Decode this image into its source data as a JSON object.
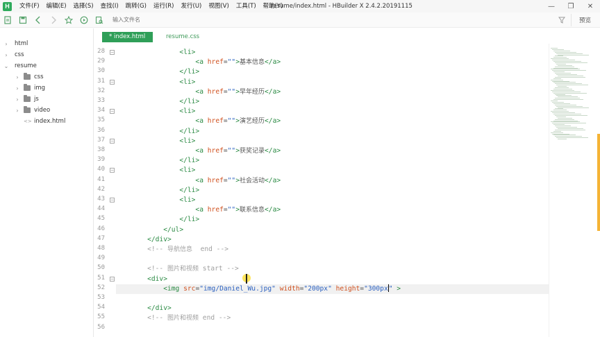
{
  "titlebar": {
    "menu": [
      "文件(F)",
      "编辑(E)",
      "选择(S)",
      "查找(I)",
      "跳转(G)",
      "运行(R)",
      "发行(U)",
      "视图(V)",
      "工具(T)",
      "帮助(Y)"
    ],
    "window_title": "resume/index.html - HBuilder X 2.4.2.20191115",
    "controls": [
      "minimize",
      "restore",
      "close"
    ]
  },
  "toolbar": {
    "search_placeholder": "输入文件名",
    "preview_label": "预览",
    "icons": [
      "new-file-icon",
      "save-icon",
      "back-icon",
      "forward-icon",
      "star-icon",
      "run-icon",
      "browser-preview-icon"
    ]
  },
  "sidebar": {
    "items": [
      {
        "label": "html",
        "type": "folder",
        "expanded": false,
        "depth": 0
      },
      {
        "label": "css",
        "type": "folder",
        "expanded": false,
        "depth": 0
      },
      {
        "label": "resume",
        "type": "folder",
        "expanded": true,
        "depth": 0
      },
      {
        "label": "css",
        "type": "folder",
        "expanded": false,
        "depth": 1
      },
      {
        "label": "img",
        "type": "folder",
        "expanded": false,
        "depth": 1
      },
      {
        "label": "js",
        "type": "folder",
        "expanded": false,
        "depth": 1
      },
      {
        "label": "video",
        "type": "folder",
        "expanded": false,
        "depth": 1
      },
      {
        "label": "index.html",
        "type": "file",
        "depth": 1
      }
    ]
  },
  "tabs": [
    {
      "label": "* index.html",
      "active": true
    },
    {
      "label": "resume.css",
      "active": false
    }
  ],
  "editor": {
    "current_line": 52,
    "lines": [
      {
        "n": "28",
        "fold": true,
        "text": "            <li>"
      },
      {
        "n": "29",
        "fold": false,
        "text": "                <a href=\"\">基本信息</a>"
      },
      {
        "n": "30",
        "fold": false,
        "text": "            </li>"
      },
      {
        "n": "31",
        "fold": true,
        "text": "            <li>"
      },
      {
        "n": "32",
        "fold": false,
        "text": "                <a href=\"\">早年经历</a>"
      },
      {
        "n": "33",
        "fold": false,
        "text": "            </li>"
      },
      {
        "n": "34",
        "fold": true,
        "text": "            <li>"
      },
      {
        "n": "35",
        "fold": false,
        "text": "                <a href=\"\">演艺经历</a>"
      },
      {
        "n": "36",
        "fold": false,
        "text": "            </li>"
      },
      {
        "n": "37",
        "fold": true,
        "text": "            <li>"
      },
      {
        "n": "38",
        "fold": false,
        "text": "                <a href=\"\">获奖记录</a>"
      },
      {
        "n": "39",
        "fold": false,
        "text": "            </li>"
      },
      {
        "n": "40",
        "fold": true,
        "text": "            <li>"
      },
      {
        "n": "41",
        "fold": false,
        "text": "                <a href=\"\">社会活动</a>"
      },
      {
        "n": "42",
        "fold": false,
        "text": "            </li>"
      },
      {
        "n": "43",
        "fold": true,
        "text": "            <li>"
      },
      {
        "n": "44",
        "fold": false,
        "text": "                <a href=\"\">联系信息</a>"
      },
      {
        "n": "45",
        "fold": false,
        "text": "            </li>"
      },
      {
        "n": "46",
        "fold": false,
        "text": "        </ul>"
      },
      {
        "n": "47",
        "fold": false,
        "text": "    </div>"
      },
      {
        "n": "48",
        "fold": false,
        "text": "    <!-- 导航信息  end -->"
      },
      {
        "n": "49",
        "fold": false,
        "text": ""
      },
      {
        "n": "50",
        "fold": false,
        "text": "    <!-- 图片和视频 start -->"
      },
      {
        "n": "51",
        "fold": true,
        "text": "    <div>"
      },
      {
        "n": "52",
        "fold": false,
        "text": "        <img src=\"img/Daniel_Wu.jpg\" width=\"200px\" height=\"300px\" >"
      },
      {
        "n": "53",
        "fold": false,
        "text": ""
      },
      {
        "n": "54",
        "fold": false,
        "text": "    </div>"
      },
      {
        "n": "55",
        "fold": false,
        "text": "    <!-- 图片和视频 end -->"
      },
      {
        "n": "56",
        "fold": false,
        "text": ""
      }
    ]
  },
  "colors": {
    "accent": "#2f9f58",
    "tag": "#2a8a43",
    "attribute": "#d0501e",
    "string": "#2a60c0",
    "comment": "#a0a0a0",
    "scrollbar": "#f5b335"
  }
}
